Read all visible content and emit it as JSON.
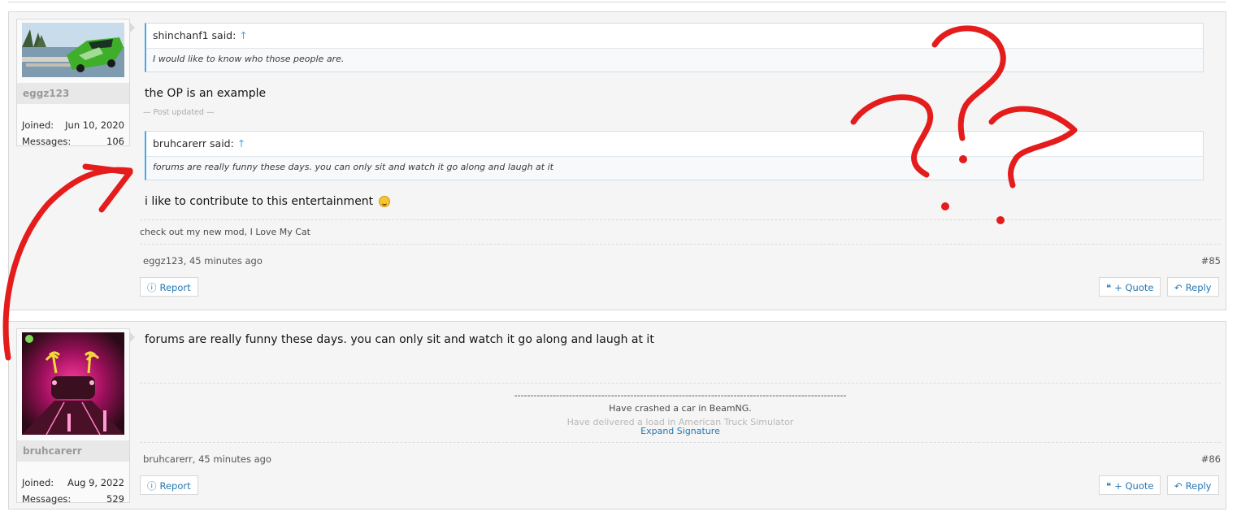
{
  "post1": {
    "username": "eggz123",
    "joined_label": "Joined:",
    "joined_value": "Jun 10, 2020",
    "messages_label": "Messages:",
    "messages_value": "106",
    "quote1_author": "shinchanf1 said:",
    "quote1_up": "↑",
    "quote1_text": "I would like to know who those people are.",
    "body1": "the OP is an example",
    "updated_note": "— Post updated —",
    "quote2_author": "bruhcarerr said:",
    "quote2_up": "↑",
    "quote2_text": "forums are really funny these days. you can only sit and watch it go along and laugh at it",
    "body2": "i like to contribute to this entertainment",
    "signature": "check out my new mod, I Love My Cat",
    "meta": "eggz123, 45 minutes ago",
    "post_number": "#85",
    "report_label": "Report",
    "quote_label": "+ Quote",
    "reply_label": "Reply"
  },
  "post2": {
    "username": "bruhcarerr",
    "joined_label": "Joined:",
    "joined_value": "Aug 9, 2022",
    "messages_label": "Messages:",
    "messages_value": "529",
    "body": "forums are really funny these days. you can only sit and watch it go along and laugh at it",
    "sig_rule": "-------------------------------------------------------------------------------------------------------",
    "sig_line1": "Have crashed a car in BeamNG.",
    "sig_line2": "Have delivered a load in American Truck Simulator",
    "expand_label": "Expand Signature",
    "meta": "bruhcarerr, 45 minutes ago",
    "post_number": "#86",
    "report_label": "Report",
    "quote_label": "+ Quote",
    "reply_label": "Reply"
  },
  "icons": {
    "report": "info-circle-icon",
    "quote": "quote-icon",
    "reply": "reply-icon"
  },
  "colors": {
    "link": "#2577b1",
    "quote_bar": "#47a7eb",
    "annotation": "#e51c1c"
  }
}
